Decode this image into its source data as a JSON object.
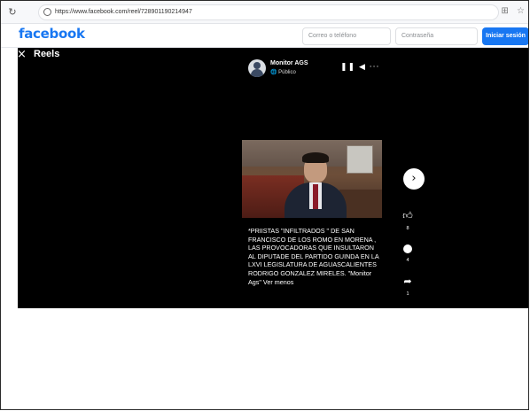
{
  "browser": {
    "reload_icon": "reload-icon",
    "url": "https://www.facebook.com/reel/728901190214947",
    "toolbar_icons": "⊞ ☆"
  },
  "header": {
    "logo": "facebook",
    "email_placeholder": "Correo o teléfono",
    "password_placeholder": "Contraseña",
    "login_label": "Iniciar sesión",
    "accent": "#1877f2"
  },
  "reels": {
    "close_icon": "×",
    "title": "Reels",
    "channel_name": "Monitor AGS",
    "privacy": "Público",
    "controls": "❚❚ ◀ ···",
    "caption": "*PRIISTAS \"INFILTRADOS \" DE SAN FRANCISCO DE LOS ROMO EN MORENA , LAS PROVOCADORAS  QUE INSULTARON AL DIPUTADE DEL PARTIDO GUINDA EN LA LXVI LEGISLATURA DE AGUASCALIENTES RODRIGO GONZALEZ MIRELES.          \"Monitor Ags\" Ver menos",
    "next_icon": "›",
    "likes": "8",
    "comments": "4",
    "shares": "1"
  }
}
